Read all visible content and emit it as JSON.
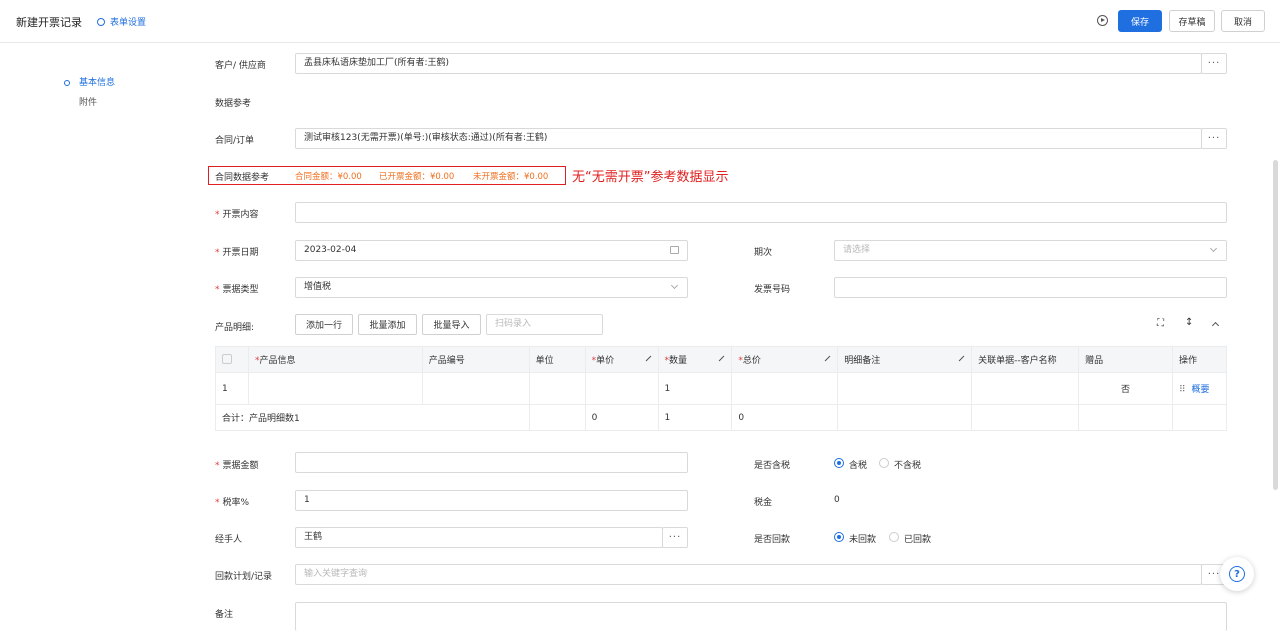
{
  "header": {
    "title": "新建开票记录",
    "form_setting": "表单设置",
    "save": "保存",
    "draft": "存草稿",
    "cancel": "取消"
  },
  "side_nav": {
    "items": [
      {
        "label": "基本信息",
        "active": true
      },
      {
        "label": "附件",
        "active": false
      }
    ]
  },
  "form": {
    "customer_label": "客户/ 供应商",
    "customer_value": "孟县床私语床垫加工厂(所有者:王鹤)",
    "data_ref_label": "数据参考",
    "contract_label": "合同/订单",
    "contract_value": "测试审核123(无需开票)(单号:)(审核状态:通过)(所有者:王鹤)",
    "contract_ref_label": "合同数据参考",
    "contract_amount": "合同金额：¥0.00",
    "invoiced_amount": "已开票金额：¥0.00",
    "uninvoiced_amount": "未开票金额：¥0.00",
    "annotation": "无“无需开票”参考数据显示",
    "content_label": "开票内容",
    "date_label": "开票日期",
    "date_value": "2023-02-04",
    "period_label": "期次",
    "period_placeholder": "请选择",
    "type_label": "票据类型",
    "type_value": "增值税",
    "invoice_no_label": "发票号码",
    "product_label": "产品明细:",
    "add_row": "添加一行",
    "batch_add": "批量添加",
    "batch_import": "批量导入",
    "scan_placeholder": "扫码录入",
    "amount_label": "票据金额",
    "tax_incl_label": "是否含税",
    "tax_incl": "含税",
    "tax_excl": "不含税",
    "tax_rate_label": "税率%",
    "tax_rate_value": "1",
    "tax_label": "税金",
    "tax_value": "0",
    "handler_label": "经手人",
    "handler_value": "王鹤",
    "returned_label": "是否回款",
    "not_returned": "未回款",
    "returned": "已回款",
    "plan_label": "回款计划/记录",
    "plan_placeholder": "输入关键字查询",
    "remark_label": "备注"
  },
  "table": {
    "headers": [
      "产品信息",
      "产品编号",
      "单位",
      "单价",
      "数量",
      "总价",
      "明细备注",
      "关联单据--客户名称",
      "赠品",
      "操作"
    ],
    "row": {
      "index": "1",
      "qty": "1",
      "gift": "否",
      "action": "概要"
    },
    "total": {
      "label": "合计：产品明细数1",
      "price": "0",
      "qty": "1",
      "sum": "0"
    }
  }
}
